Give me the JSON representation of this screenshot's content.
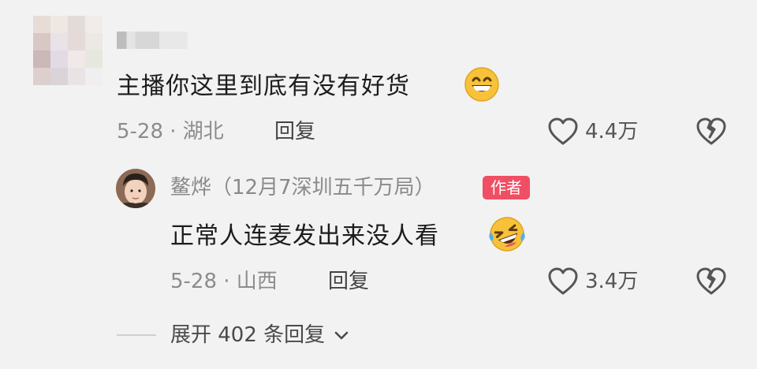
{
  "comment": {
    "text": "主播你这里到底有没有好货",
    "emoji": "grinning-face",
    "date_location": "5-28 · 湖北",
    "reply_label": "回复",
    "like_count": "4.4万"
  },
  "reply": {
    "author": "鳌烨（12月7深圳五千万局）",
    "author_badge": "作者",
    "text": "正常人连麦发出来没人看",
    "emoji": "rolling-on-floor-laughing-face",
    "date_location": "5-28 · 山西",
    "reply_label": "回复",
    "like_count": "3.4万"
  },
  "expand_label": "展开 402 条回复",
  "colors": {
    "background": "#f2f2f2",
    "badge": "#ef4f64",
    "emoji_yellow": "#f7c23a"
  }
}
